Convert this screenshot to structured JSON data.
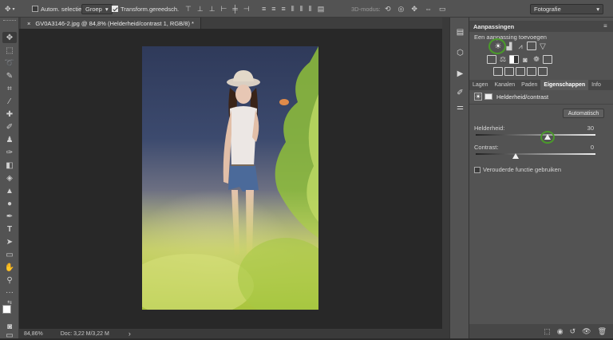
{
  "options_bar": {
    "auto_select_label": "Autom. selectie:",
    "auto_select_value": "Groep",
    "transform_label": "Transform.gereedsch.",
    "mode_3d_label": "3D-modus:",
    "workspace_value": "Fotografie"
  },
  "document": {
    "tab_title": "GV0A3146-2.jpg @ 84,8% (Helderheid/contrast 1, RGB/8) *",
    "tab_close": "×"
  },
  "status": {
    "zoom": "84,86%",
    "doc_info": "Doc: 3,22 M/3,22 M",
    "arrow": "›"
  },
  "adjustments_panel": {
    "title": "Aanpassingen",
    "subtitle": "Een aanpassing toevoegen"
  },
  "panel_tabs": [
    "Lagen",
    "Kanalen",
    "Paden",
    "Eigenschappen",
    "Info"
  ],
  "properties": {
    "layer_name": "Helderheid/contrast",
    "auto_button": "Automatisch",
    "brightness_label": "Helderheid:",
    "brightness_value": "30",
    "brightness_level": 30,
    "contrast_label": "Contrast:",
    "contrast_value": "0",
    "contrast_level": 0,
    "legacy_label": "Verouderde functie gebruiken"
  },
  "colors": {
    "accent_ring": "#4a9a2a",
    "panel_bg": "#535353",
    "canvas_bg": "#282828"
  }
}
